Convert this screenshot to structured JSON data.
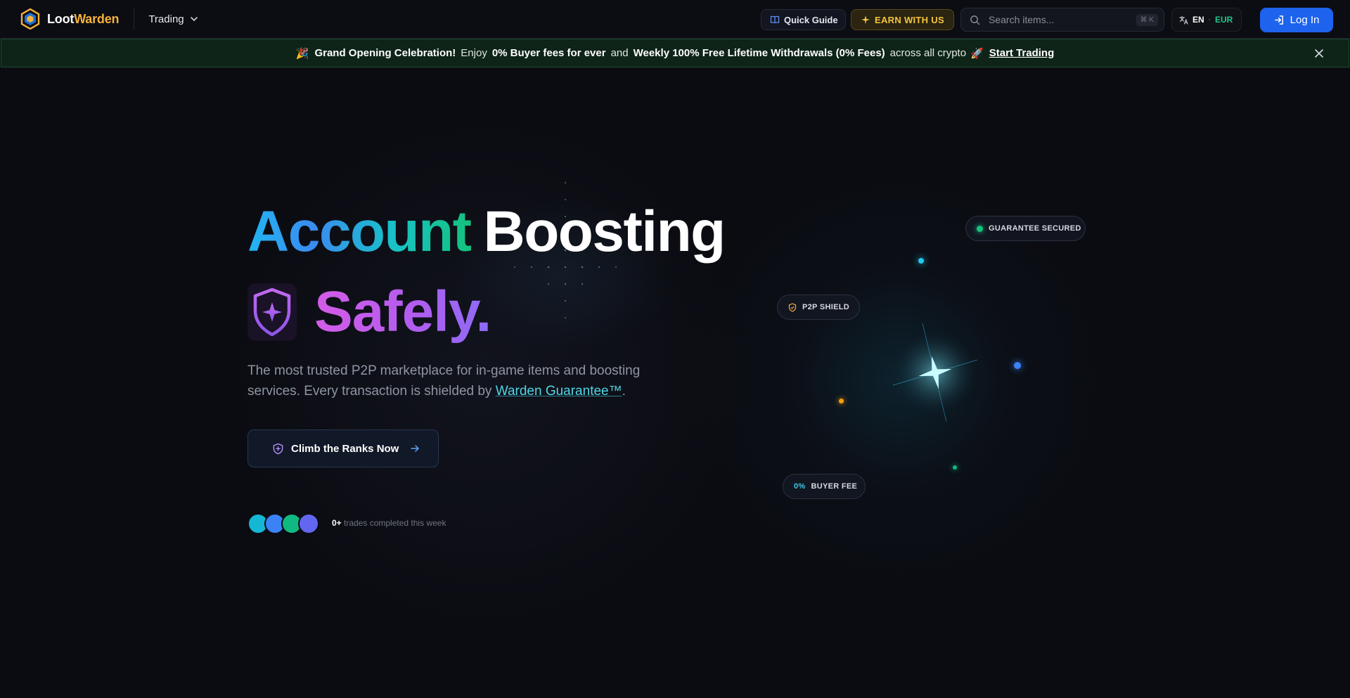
{
  "header": {
    "logo": {
      "part1": "Loot",
      "part2": "Warden",
      "icon": "hexagon-logo-icon"
    },
    "nav_trading": "Trading",
    "quick_guide": "Quick Guide",
    "earn_with_us": "EARN WITH US",
    "search_placeholder": "Search items...",
    "search_shortcut": "⌘ K",
    "language": "EN",
    "currency": "EUR",
    "login": "Log In"
  },
  "announcement": {
    "emoji_start": "🎉",
    "headline": "Grand Opening Celebration!",
    "enjoy": "Enjoy",
    "offer1": "0% Buyer fees for ever",
    "and": "and",
    "offer2": "Weekly 100% Free Lifetime Withdrawals (0% Fees)",
    "tail": "across all crypto",
    "emoji_end": "🚀",
    "cta": "Start Trading"
  },
  "hero": {
    "word1": "Account",
    "word2": "Boosting",
    "word3": "Safely.",
    "description_pre": "The most trusted P2P marketplace for in-game items and boosting services. Every transaction is shielded by",
    "description_link": "Warden Guarantee™",
    "description_post": ".",
    "cta": "Climb the Ranks Now",
    "trades_count": "0+",
    "trades_label": "trades completed this week"
  },
  "visual": {
    "pill_guarantee": "GUARANTEE SECURED",
    "pill_p2p": "P2P SHIELD",
    "pill_fee_pct": "0%",
    "pill_fee_label": "BUYER FEE"
  },
  "colors": {
    "brand_gold": "#f4b13a",
    "primary_blue": "#1d63ed",
    "accent_cyan": "#4fd6e6",
    "success_green": "#14c27d",
    "purple": "#b35cf0",
    "avatars": [
      "#14b8d4",
      "#3b82f6",
      "#10b981",
      "#6366f1"
    ]
  }
}
